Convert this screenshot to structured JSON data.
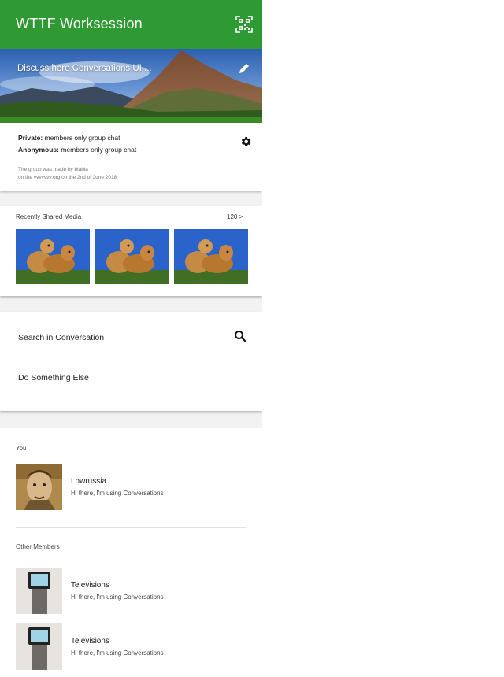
{
  "appbar": {
    "title": "WTTF Worksession",
    "qr_icon": "qr-code-icon",
    "color": "#2f9a33"
  },
  "banner": {
    "text": "Discuss here Conversations UI ...",
    "edit_icon": "pencil-icon"
  },
  "info": {
    "private_label": "Private:",
    "private_value": " members only group chat",
    "anonymous_label": "Anonymous:",
    "anonymous_value": " members only group chat",
    "meta_line1": "The group was made by blabla",
    "meta_line2": "on the vvvvvvv.org on the 2nd of June 2018",
    "settings_icon": "gear-icon"
  },
  "media": {
    "label": "Recently Shared Media",
    "count": "120  >",
    "thumbnails": [
      "dogs-photo",
      "dogs-photo",
      "dogs-photo"
    ]
  },
  "actions": {
    "search_label": "Search in Conversation",
    "other_label": "Do Something Else",
    "search_icon": "search-icon"
  },
  "members": {
    "you_label": "You",
    "others_label": "Other Members",
    "self": {
      "name": "Lowrussia",
      "status": "Hi there, I'm using Conversations"
    },
    "list": [
      {
        "name": "Televisions",
        "status": "Hi there, I'm using Conversations"
      },
      {
        "name": "Televisions",
        "status": "Hi there, I'm using Conversations"
      }
    ]
  }
}
